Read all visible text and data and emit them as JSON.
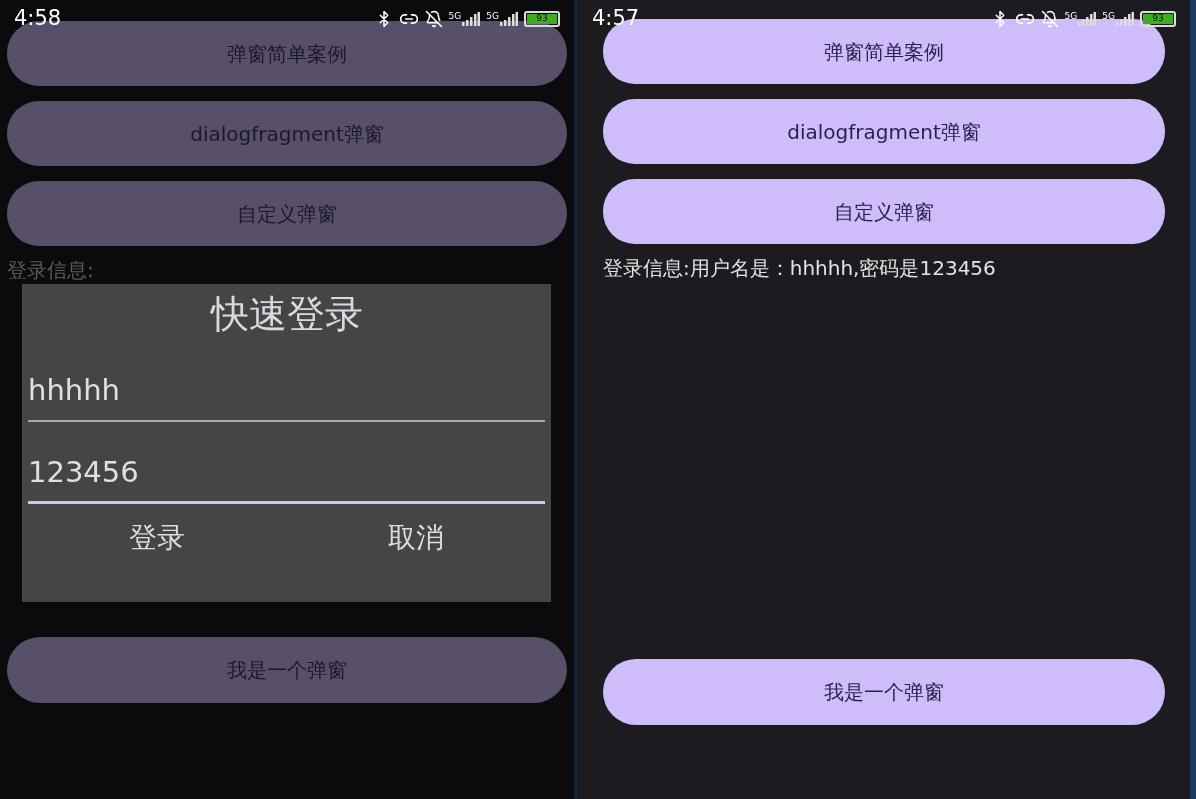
{
  "phones": [
    {
      "status_bar": {
        "time": "4:58",
        "network_labels": [
          "5G",
          "5G"
        ],
        "battery": "93"
      },
      "buttons": [
        "弹窗简单案例",
        "dialogfragment弹窗",
        "自定义弹窗"
      ],
      "login_info": "登录信息:",
      "dialog": {
        "title": "快速登录",
        "fields": [
          {
            "value": "hhhhh",
            "focused": false
          },
          {
            "value": "123456",
            "focused": true
          }
        ],
        "actions": [
          "登录",
          "取消"
        ]
      },
      "bottom_button": "我是一个弹窗"
    },
    {
      "status_bar": {
        "time": "4:57",
        "network_labels": [
          "5G",
          "5G"
        ],
        "battery": "93"
      },
      "buttons": [
        "弹窗简单案例",
        "dialogfragment弹窗",
        "自定义弹窗"
      ],
      "login_info": "登录信息:用户名是：hhhhh,密码是123456",
      "bottom_button": "我是一个弹窗"
    }
  ]
}
